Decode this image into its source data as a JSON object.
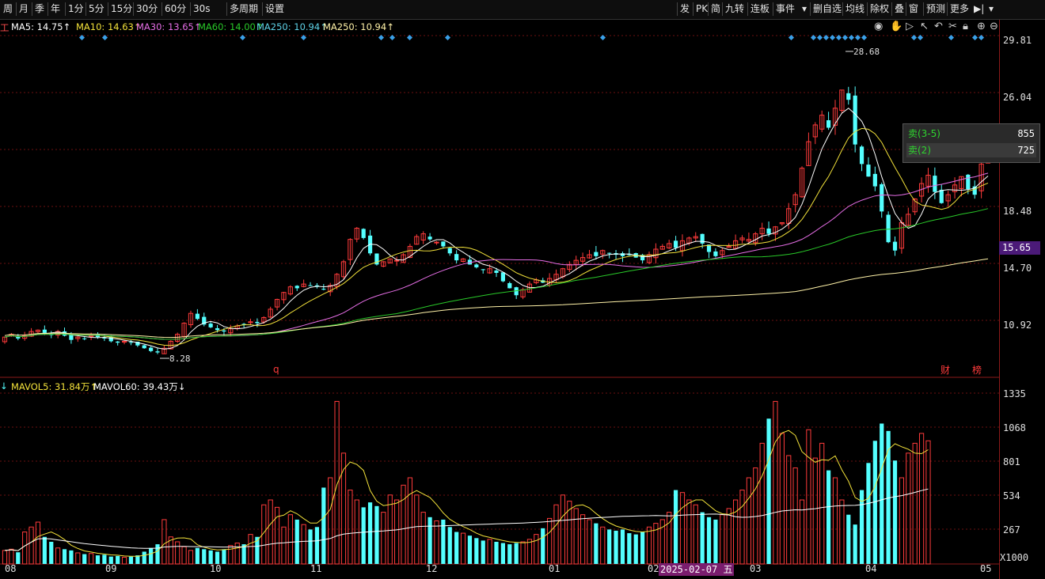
{
  "toolbar": {
    "left": [
      "周",
      "月",
      "季",
      "年",
      "1分",
      "5分",
      "15分",
      "30分",
      "60分",
      "30s",
      "多周期",
      "设置"
    ],
    "right": [
      "发",
      "PK",
      "简",
      "九转",
      "连板",
      "事件",
      "删自选",
      "均线",
      "除权",
      "叠",
      "窗",
      "预测",
      "更多"
    ]
  },
  "ma_legend": [
    {
      "label": "MA5: 14.75↑",
      "color": "#ffffff"
    },
    {
      "label": "MA10: 14.63↑",
      "color": "#f2e13a"
    },
    {
      "label": "MA30: 13.65↑",
      "color": "#e66ee6"
    },
    {
      "label": "MA60: 14.00↑",
      "color": "#29c929"
    },
    {
      "label": "MA250: 10.94↑",
      "color": "#5fd3e8"
    },
    {
      "label": "MA250: 10.94↑",
      "color": "#fff2a8"
    }
  ],
  "ma_prefix": "工",
  "vol_legend": [
    {
      "label": "MAVOL5: 31.84万↑",
      "color": "#f2e13a"
    },
    {
      "label": "MAVOL60: 39.43万↓",
      "color": "#ffffff"
    }
  ],
  "vol_prefix": "↓",
  "price_axis": [
    "29.81",
    "26.04",
    "22.26",
    "18.48",
    "14.70",
    "10.92"
  ],
  "current_price": "15.65",
  "volume_axis": [
    "1335",
    "1068",
    "801",
    "534",
    "267"
  ],
  "volume_unit": "X1000",
  "annotations": {
    "high": "28.68",
    "low": "8.28",
    "q_marker": "q",
    "cai": "财",
    "bang": "榜"
  },
  "order_popup": [
    {
      "label": "卖(3-5)",
      "value": "855"
    },
    {
      "label": "卖(2)",
      "value": "725"
    }
  ],
  "x_axis": [
    "08",
    "09",
    "10",
    "11",
    "12",
    "01",
    "02",
    "03",
    "04",
    "05"
  ],
  "highlight_date": "2025-02-07 五",
  "colors": {
    "up": "#ff3b3b",
    "down": "#54ffff",
    "grid": "#6b1010",
    "popup_green": "#2fd42f"
  },
  "chart_data": {
    "type": "candlestick",
    "y_range": [
      7.2,
      31.0
    ],
    "volume_range": [
      0,
      1400
    ],
    "closes": [
      9.4,
      9.6,
      9.3,
      9.5,
      9.8,
      9.9,
      9.7,
      9.6,
      9.8,
      9.5,
      9.2,
      9.4,
      9.3,
      9.5,
      9.4,
      9.3,
      9.1,
      9.0,
      9.1,
      9.0,
      8.8,
      8.6,
      8.4,
      8.3,
      8.6,
      9.1,
      9.6,
      10.4,
      11.1,
      10.7,
      10.3,
      10.1,
      9.9,
      9.8,
      10.0,
      10.2,
      10.3,
      10.5,
      10.4,
      10.8,
      11.4,
      12.1,
      12.6,
      13.0,
      12.9,
      13.2,
      13.1,
      13.0,
      12.8,
      13.1,
      13.9,
      14.8,
      16.4,
      17.2,
      16.5,
      15.4,
      14.6,
      14.8,
      15.0,
      14.9,
      15.3,
      15.9,
      16.6,
      16.8,
      16.4,
      16.2,
      15.9,
      15.4,
      14.9,
      15.0,
      14.6,
      14.4,
      14.2,
      14.3,
      14.0,
      13.4,
      12.9,
      12.4,
      12.8,
      13.2,
      13.5,
      13.3,
      13.6,
      13.9,
      14.3,
      14.6,
      14.9,
      15.1,
      15.3,
      15.2,
      15.6,
      15.4,
      15.3,
      15.2,
      15.3,
      15.1,
      14.9,
      15.3,
      15.7,
      15.9,
      16.1,
      15.8,
      16.3,
      16.5,
      16.6,
      16.1,
      15.5,
      15.2,
      15.6,
      15.9,
      16.3,
      16.5,
      16.4,
      16.8,
      17.2,
      16.8,
      17.3,
      17.6,
      18.6,
      19.6,
      21.5,
      23.4,
      24.6,
      25.3,
      24.4,
      25.8,
      27.1,
      26.4,
      23.2,
      21.8,
      20.9,
      20.2,
      18.4,
      16.2,
      15.6,
      17.6,
      18.2,
      19.3,
      20.4,
      21.0,
      19.8,
      19.0,
      19.6,
      20.3,
      20.9,
      20.0,
      19.6,
      21.8,
      22.4
    ],
    "volumes": [
      110,
      120,
      95,
      260,
      300,
      340,
      220,
      180,
      130,
      120,
      110,
      90,
      80,
      85,
      70,
      75,
      60,
      65,
      55,
      60,
      70,
      100,
      130,
      160,
      360,
      220,
      180,
      140,
      110,
      130,
      120,
      110,
      100,
      120,
      150,
      170,
      160,
      240,
      220,
      480,
      520,
      460,
      300,
      400,
      360,
      320,
      280,
      300,
      620,
      700,
      1320,
      900,
      600,
      520,
      460,
      500,
      470,
      420,
      560,
      520,
      640,
      700,
      560,
      420,
      380,
      350,
      360,
      300,
      260,
      250,
      230,
      210,
      190,
      200,
      180,
      170,
      160,
      170,
      180,
      200,
      240,
      290,
      370,
      480,
      560,
      510,
      450,
      400,
      360,
      330,
      300,
      280,
      270,
      280,
      250,
      240,
      260,
      300,
      330,
      360,
      420,
      600,
      580,
      520,
      480,
      420,
      380,
      360,
      400,
      450,
      520,
      600,
      700,
      780,
      980,
      1180,
      1320,
      1060,
      880,
      780,
      520,
      1090,
      860,
      980,
      760,
      700,
      520,
      400,
      320,
      600,
      820,
      1000,
      1140,
      1080,
      840,
      700,
      900,
      980,
      1060,
      1000
    ]
  }
}
